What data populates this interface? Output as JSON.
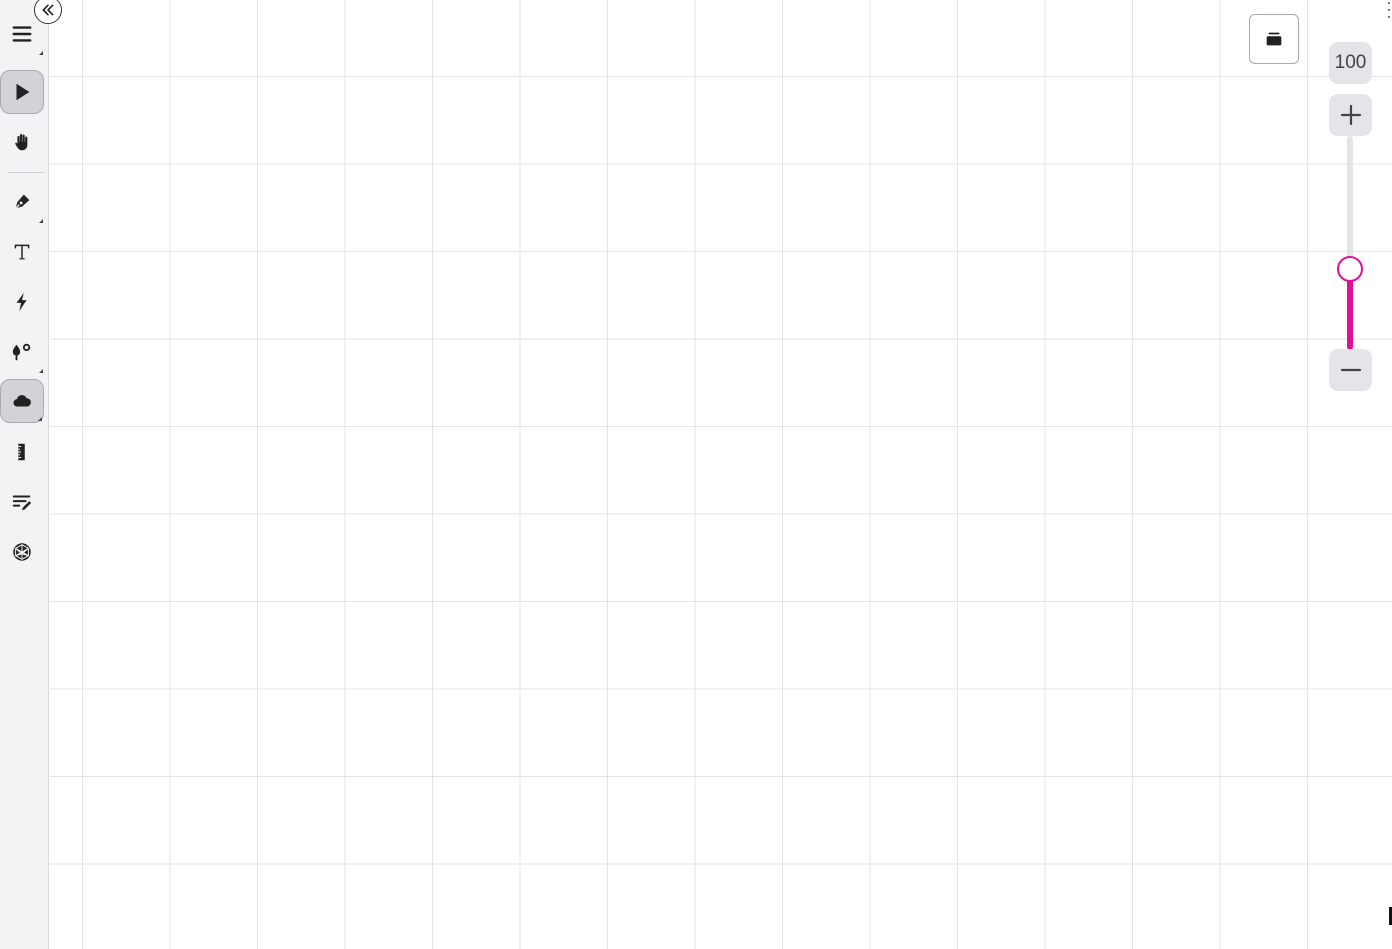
{
  "app": {
    "accent_color": "#e0109a",
    "canvas_color": "#ffffff",
    "grid_color": "#e3e3e8"
  },
  "toolbar": {
    "collapse_icon": "double-chevron-left-icon",
    "menu_icon": "hamburger-menu-icon",
    "tools": [
      {
        "name": "select",
        "icon": "pointer-arrow-icon",
        "active": true,
        "has_submenu": false
      },
      {
        "name": "pan",
        "icon": "hand-icon",
        "active": false,
        "has_submenu": false
      },
      {
        "name": "pen",
        "icon": "pen-nib-icon",
        "active": false,
        "has_submenu": true
      },
      {
        "name": "text",
        "icon": "text-t-icon",
        "active": false,
        "has_submenu": false
      },
      {
        "name": "laser",
        "icon": "lightning-icon",
        "active": false,
        "has_submenu": false
      },
      {
        "name": "fill",
        "icon": "paint-drop-icon",
        "active": false,
        "has_submenu": true
      },
      {
        "name": "cloud",
        "icon": "cloud-icon",
        "active": true,
        "has_submenu": true
      },
      {
        "name": "ruler",
        "icon": "ruler-icon",
        "active": false,
        "has_submenu": false
      },
      {
        "name": "edit-text",
        "icon": "lines-pencil-icon",
        "active": false,
        "has_submenu": false
      },
      {
        "name": "polyhedron",
        "icon": "polyhedron-icon",
        "active": false,
        "has_submenu": false
      }
    ]
  },
  "top_button": {
    "icon": "tray-icon"
  },
  "zoom": {
    "value": "100",
    "level_fraction": 0.38,
    "plus_icon": "plus-icon",
    "minus_icon": "minus-icon"
  }
}
